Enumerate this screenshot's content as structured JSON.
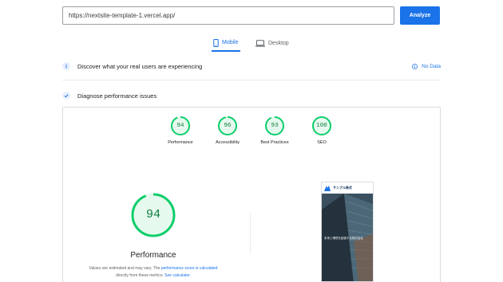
{
  "search": {
    "url": "https://nextsite-template-1.vercel.app/"
  },
  "toolbar": {
    "analyze_label": "Analyze"
  },
  "tabs": [
    {
      "label": "Mobile"
    },
    {
      "label": "Desktop"
    }
  ],
  "discover": {
    "text": "Discover what your real users are experiencing",
    "status": "No Data"
  },
  "diagnose": {
    "text": "Diagnose performance issues"
  },
  "scores": [
    {
      "label": "Performance",
      "value": "94",
      "score": 0.94
    },
    {
      "label": "Accessibility",
      "value": "96",
      "score": 0.96
    },
    {
      "label": "Best Practices",
      "value": "93",
      "score": 0.93
    },
    {
      "label": "SEO",
      "value": "100",
      "score": 1.0
    }
  ],
  "performance": {
    "value": "94",
    "score": 0.94,
    "title": "Performance",
    "note_prefix": "Values are estimated and may vary. The",
    "note_link1": "performance score is calculated",
    "note_mid": "directly from these metrics.",
    "note_link2": "See calculator."
  },
  "preview": {
    "brand": "サンプル株式",
    "caption": "未来と環境を創造する株式会社"
  },
  "colors": {
    "accent": "#1a73e8",
    "pass": "#0cce6b",
    "pass_text": "#0c7c3c",
    "pass_bg": "#e6f9ee"
  },
  "icons": {
    "mobile": "mobile-icon",
    "desktop": "laptop-icon",
    "info": "info-icon",
    "diagnose": "checklist-icon"
  }
}
